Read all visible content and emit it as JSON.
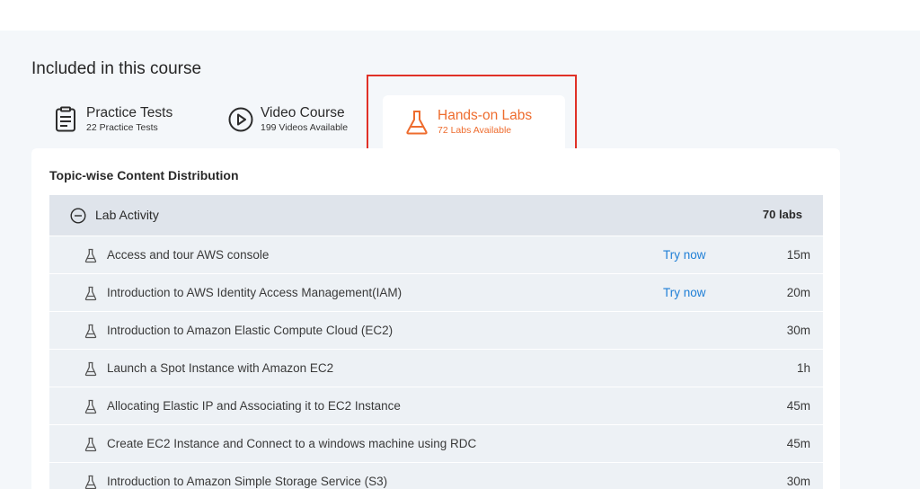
{
  "heading": "Included in this course",
  "tabs": {
    "practice": {
      "title": "Practice Tests",
      "subtitle": "22 Practice Tests",
      "icon": "clipboard-list-icon"
    },
    "video": {
      "title": "Video Course",
      "subtitle": "199 Videos Available",
      "icon": "play-circle-icon"
    },
    "labs": {
      "title": "Hands-on Labs",
      "subtitle": "72 Labs Available",
      "icon": "flask-icon"
    }
  },
  "content": {
    "title": "Topic-wise Content Distribution",
    "group": {
      "label": "Lab Activity",
      "count": "70 labs"
    },
    "labs": [
      {
        "title": "Access and tour AWS console",
        "try": "Try now",
        "duration": "15m"
      },
      {
        "title": "Introduction to AWS Identity Access Management(IAM)",
        "try": "Try now",
        "duration": "20m"
      },
      {
        "title": "Introduction to Amazon Elastic Compute Cloud (EC2)",
        "try": "",
        "duration": "30m"
      },
      {
        "title": "Launch a Spot Instance with Amazon EC2",
        "try": "",
        "duration": "1h"
      },
      {
        "title": "Allocating Elastic IP and Associating it to EC2 Instance",
        "try": "",
        "duration": "45m"
      },
      {
        "title": "Create EC2 Instance and Connect to a windows machine using RDC",
        "try": "",
        "duration": "45m"
      },
      {
        "title": "Introduction to Amazon Simple Storage Service (S3)",
        "try": "",
        "duration": "30m"
      }
    ]
  },
  "colors": {
    "accent": "#ee6c2e",
    "link": "#1f7fd6",
    "highlight": "#e03127",
    "rowBg": "#edf1f5",
    "headerBg": "#dfe4eb"
  }
}
